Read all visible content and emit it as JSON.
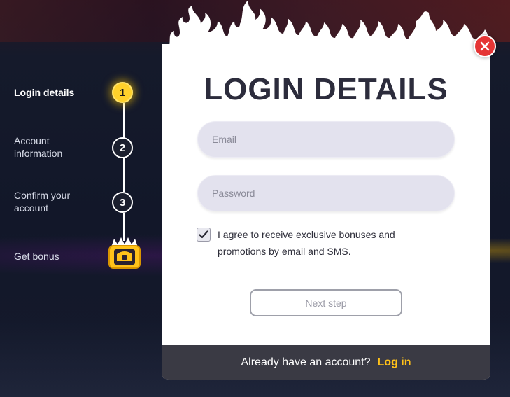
{
  "steps": [
    {
      "label": "Login details",
      "number": "1",
      "state": "current"
    },
    {
      "label": "Account information",
      "number": "2",
      "state": "upcoming"
    },
    {
      "label": "Confirm your account",
      "number": "3",
      "state": "upcoming"
    },
    {
      "label": "Get bonus",
      "icon": "treasure-chest-icon"
    }
  ],
  "modal": {
    "title": "LOGIN DETAILS",
    "email": {
      "placeholder": "Email",
      "value": ""
    },
    "password": {
      "placeholder": "Password",
      "value": ""
    },
    "consent": {
      "checked": true,
      "text": "I agree to receive exclusive bonuses and promotions by email and SMS."
    },
    "next_label": "Next step",
    "footer": {
      "text": "Already have an account?",
      "link": "Log in"
    },
    "close_icon": "close-icon"
  },
  "colors": {
    "accent": "#ffc11a",
    "close": "#e53535",
    "footer_bg": "#3a3a44",
    "field_bg": "#e3e2ee",
    "title": "#2c2c3c"
  }
}
